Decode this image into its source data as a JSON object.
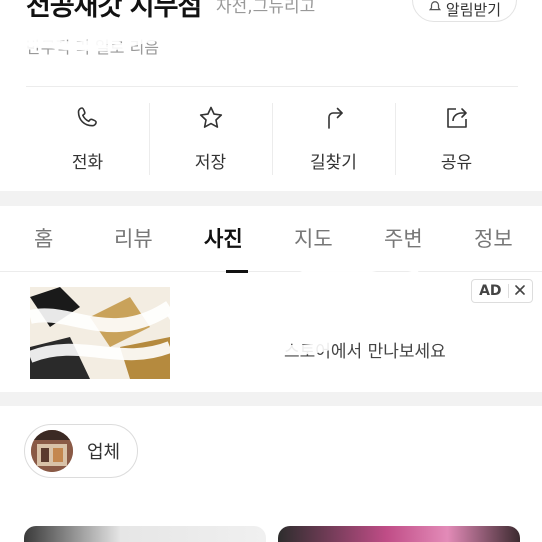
{
  "header": {
    "title": "천공새갓 시무점",
    "category": "자전,그뉴리고",
    "alarm_label": "알림받기",
    "sub_text": "반무적 리                 일로        리음"
  },
  "actions": [
    {
      "label": "전화",
      "icon": "phone-icon"
    },
    {
      "label": "저장",
      "icon": "star-icon"
    },
    {
      "label": "길찾기",
      "icon": "directions-icon"
    },
    {
      "label": "공유",
      "icon": "share-icon"
    }
  ],
  "tabs": [
    {
      "label": "홈",
      "active": false
    },
    {
      "label": "리뷰",
      "active": false
    },
    {
      "label": "사진",
      "active": true
    },
    {
      "label": "지도",
      "active": false
    },
    {
      "label": "주변",
      "active": false
    },
    {
      "label": "정보",
      "active": false
    }
  ],
  "ad": {
    "badge": "AD",
    "close_icon": "close-icon",
    "title": "",
    "description": "스토어에서 만나보세요"
  },
  "filter_chip": {
    "label": "업체"
  },
  "colors": {
    "divider": "#ececec",
    "band": "#f2f2f2",
    "text_primary": "#111111",
    "text_secondary": "#777777"
  }
}
